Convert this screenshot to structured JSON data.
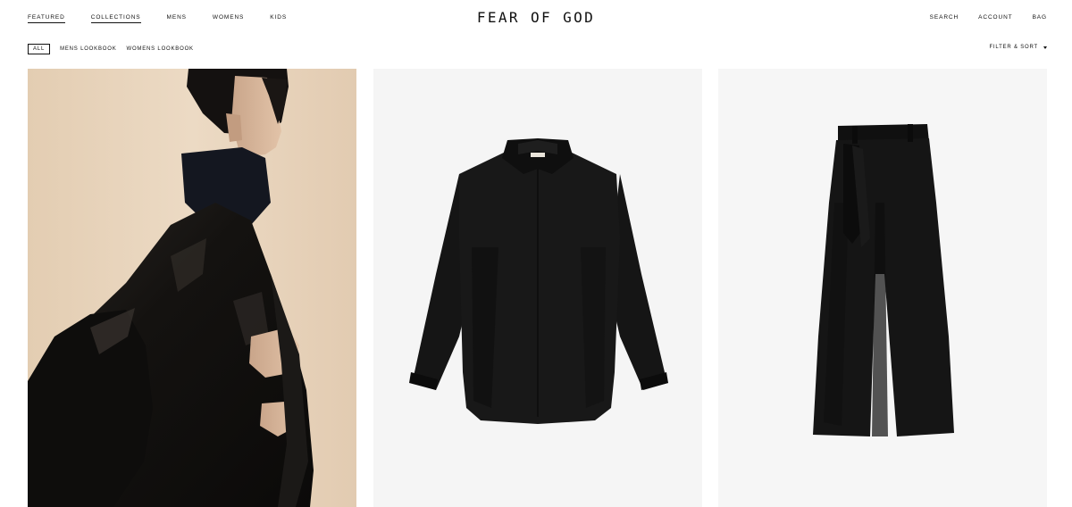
{
  "nav": {
    "left": [
      {
        "label": "FEATURED"
      },
      {
        "label": "COLLECTIONS"
      },
      {
        "label": "MENS"
      },
      {
        "label": "WOMENS"
      },
      {
        "label": "KIDS"
      }
    ],
    "logo": "FEAR OF GOD",
    "right": [
      {
        "label": "SEARCH"
      },
      {
        "label": "ACCOUNT"
      },
      {
        "label": "BAG"
      }
    ]
  },
  "subnav": {
    "tags": [
      {
        "label": "ALL",
        "active": true
      },
      {
        "label": "MENS LOOKBOOK"
      },
      {
        "label": "WOMENS LOOKBOOK"
      }
    ],
    "filter_label": "FILTER & SORT"
  },
  "products": [
    {
      "image": "model-leather-jacket-photo"
    },
    {
      "image": "black-shirt-photo"
    },
    {
      "image": "black-trousers-photo"
    }
  ],
  "colors": {
    "text": "#111111",
    "card_bg": "#f5f5f5"
  }
}
